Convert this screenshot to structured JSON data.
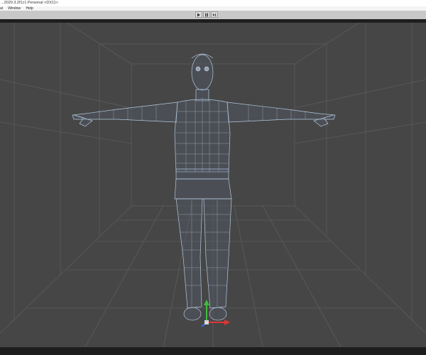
{
  "window": {
    "title": "...2020.3.2f1c1 Personal <DX11>"
  },
  "menu": {
    "items": [
      "al",
      "Window",
      "Help"
    ]
  },
  "toolbar": {
    "play_buttons": [
      "play-icon",
      "pause-icon",
      "step-icon"
    ]
  },
  "viewport": {
    "background": "#464646",
    "wire_color": "#b4c8de",
    "grid_color": "#5c5c5c",
    "gizmo": {
      "y_color": "#3fbf3f",
      "x_color": "#e03434",
      "z_color": "#3a6cf0"
    }
  }
}
